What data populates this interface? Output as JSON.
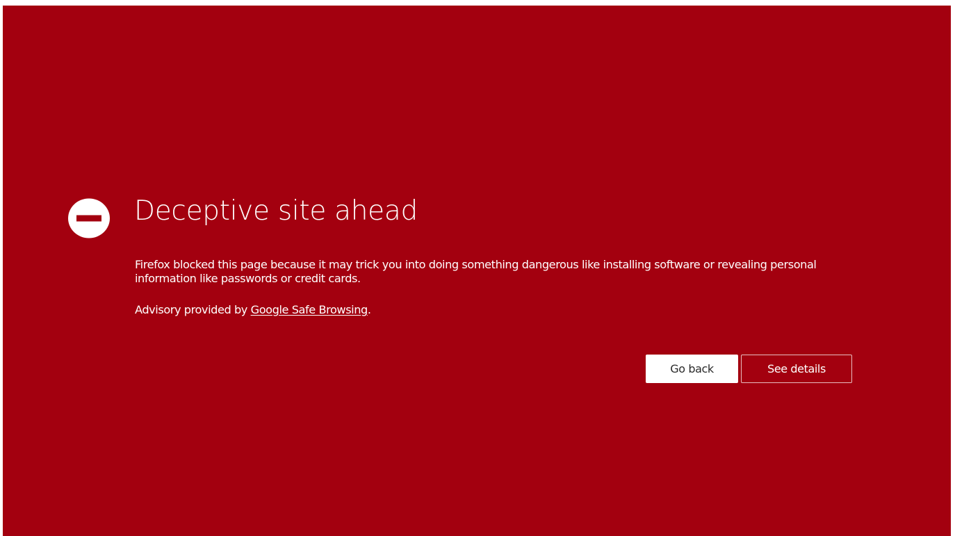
{
  "page": {
    "title": "Deceptive site ahead",
    "description": "Firefox blocked this page because it may trick you into doing something dangerous like installing software or revealing personal information like passwords or credit cards.",
    "advisory_prefix": "Advisory provided by ",
    "advisory_link": "Google Safe Browsing",
    "advisory_suffix": "."
  },
  "actions": {
    "go_back_label": "Go back",
    "see_details_label": "See details"
  },
  "icons": {
    "warning": "block-icon"
  },
  "colors": {
    "background": "#a3000f",
    "text": "#ffffff",
    "primary_button_bg": "#ffffff",
    "primary_button_text": "#2a2a2a"
  }
}
